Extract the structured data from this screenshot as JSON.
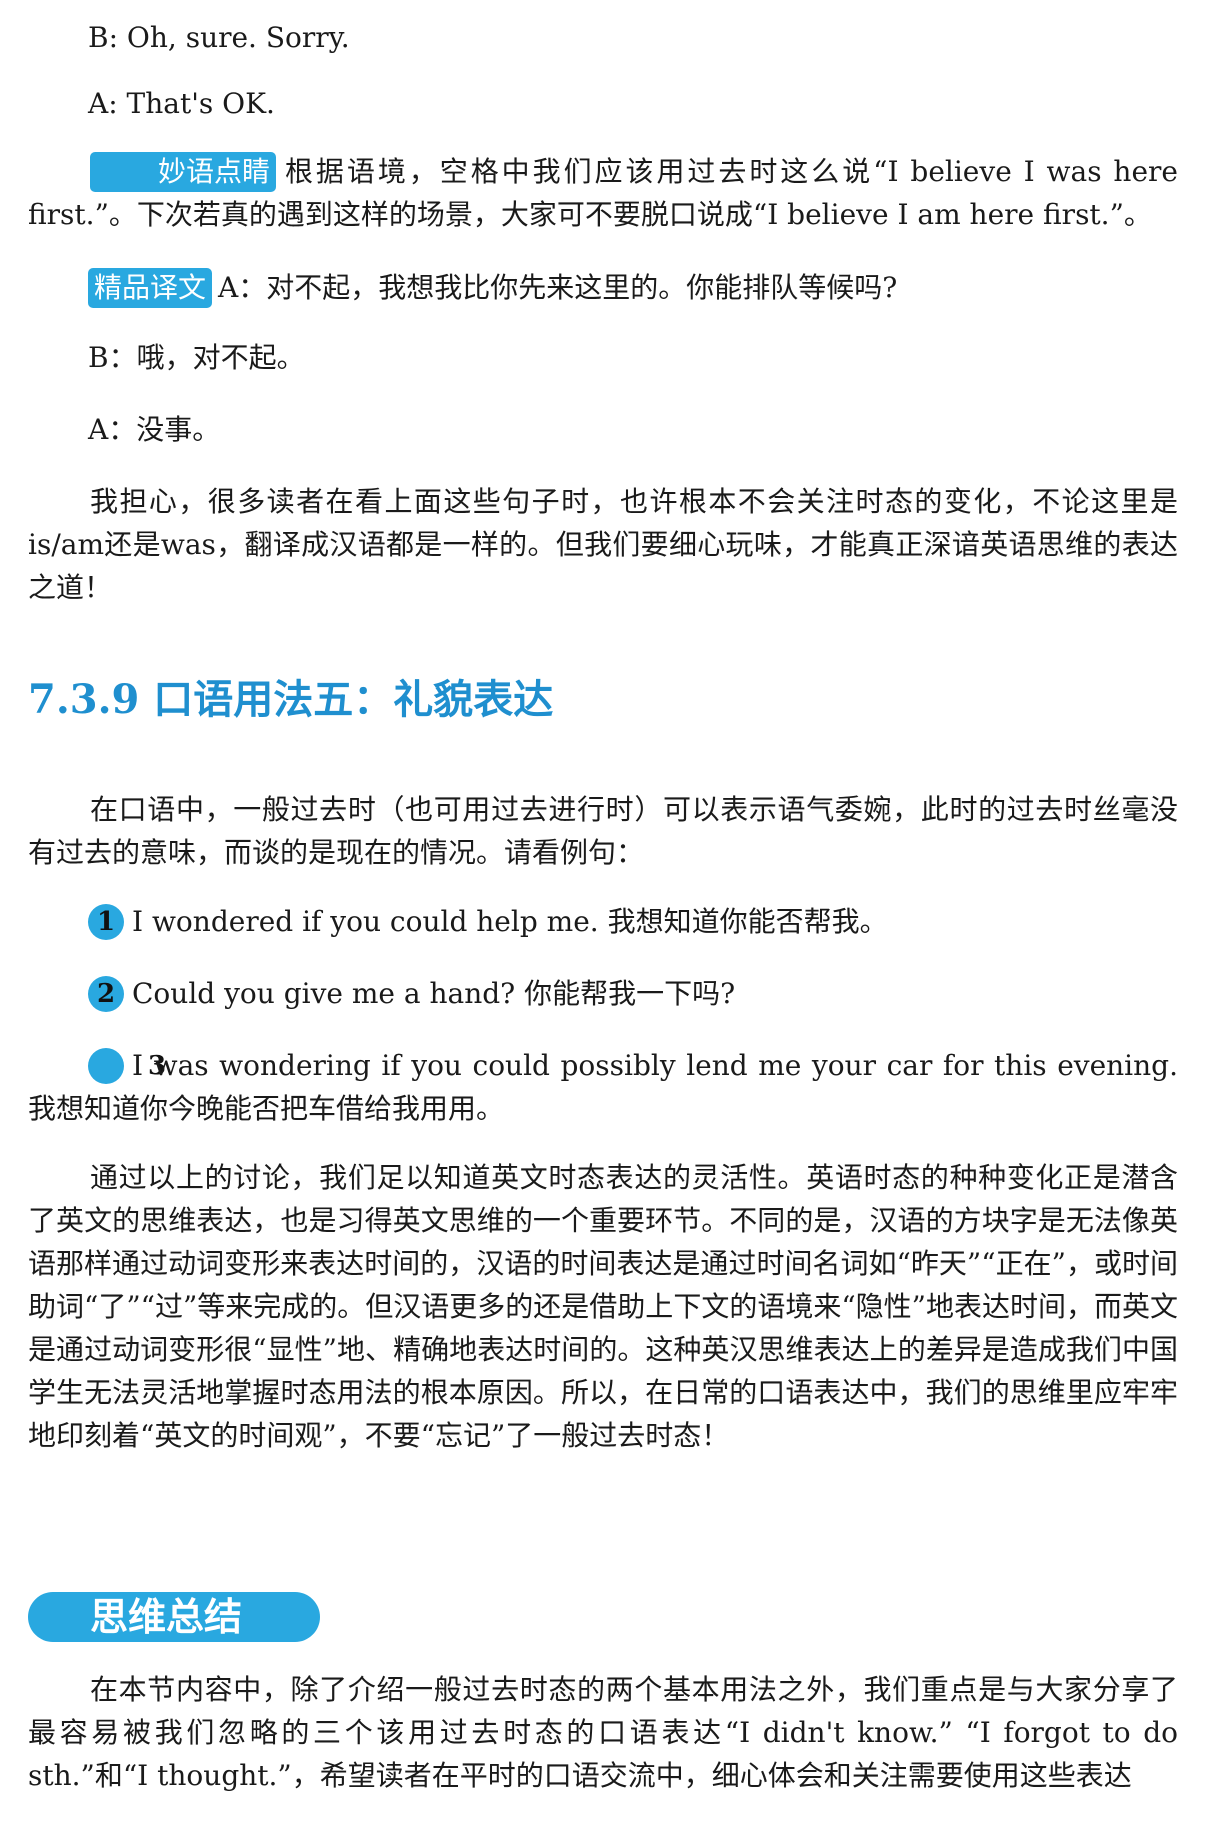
{
  "dialogue1": {
    "b_line": "B: Oh, sure. Sorry.",
    "a_line": "A: That's OK."
  },
  "insight": {
    "tag": "妙语点睛",
    "text": "根据语境，空格中我们应该用过去时这么说“I believe I was here first.”。下次若真的遇到这样的场景，大家可不要脱口说成“I believe I am here first.”。"
  },
  "translation": {
    "tag": "精品译文",
    "a_line": "A：对不起，我想我比你先来这里的。你能排队等候吗?",
    "b_line": "B：哦，对不起。",
    "a2_line": "A：没事。"
  },
  "para_worry": "我担心，很多读者在看上面这些句子时，也许根本不会关注时态的变化，不论这里是is/am还是was，翻译成汉语都是一样的。但我们要细心玩味，才能真正深谙英语思维的表达之道！",
  "section": {
    "heading": "7.3.9 口语用法五：礼貌表达",
    "intro": "在口语中，一般过去时（也可用过去进行时）可以表示语气委婉，此时的过去时丝毫没有过去的意味，而谈的是现在的情况。请看例句：",
    "examples": [
      {
        "num": "1",
        "text": "I wondered if you could help me. 我想知道你能否帮我。"
      },
      {
        "num": "2",
        "text": "Could you give me a hand? 你能帮我一下吗?"
      },
      {
        "num": "3",
        "text": "I was wondering if you could possibly lend me your car for this evening. 我想知道你今晚能否把车借给我用用。"
      }
    ],
    "discussion": "通过以上的讨论，我们足以知道英文时态表达的灵活性。英语时态的种种变化正是潜含了英文的思维表达，也是习得英文思维的一个重要环节。不同的是，汉语的方块字是无法像英语那样通过动词变形来表达时间的，汉语的时间表达是通过时间名词如“昨天”“正在”，或时间助词“了”“过”等来完成的。但汉语更多的还是借助上下文的语境来“隐性”地表达时间，而英文是通过动词变形很“显性”地、精确地表达时间的。这种英汉思维表达上的差异是造成我们中国学生无法灵活地掌握时态用法的根本原因。所以，在日常的口语表达中，我们的思维里应牢牢地印刻着“英文的时间观”，不要“忘记”了一般过去时态！"
  },
  "summary": {
    "label": "思维总结",
    "text": "在本节内容中，除了介绍一般过去时态的两个基本用法之外，我们重点是与大家分享了最容易被我们忽略的三个该用过去时态的口语表达“I didn't know.” “I forgot to do sth.”和“I thought.”，希望读者在平时的口语交流中，细心体会和关注需要使用这些表达"
  },
  "colors": {
    "accent": "#29a8e0",
    "heading": "#1f8fcf"
  }
}
